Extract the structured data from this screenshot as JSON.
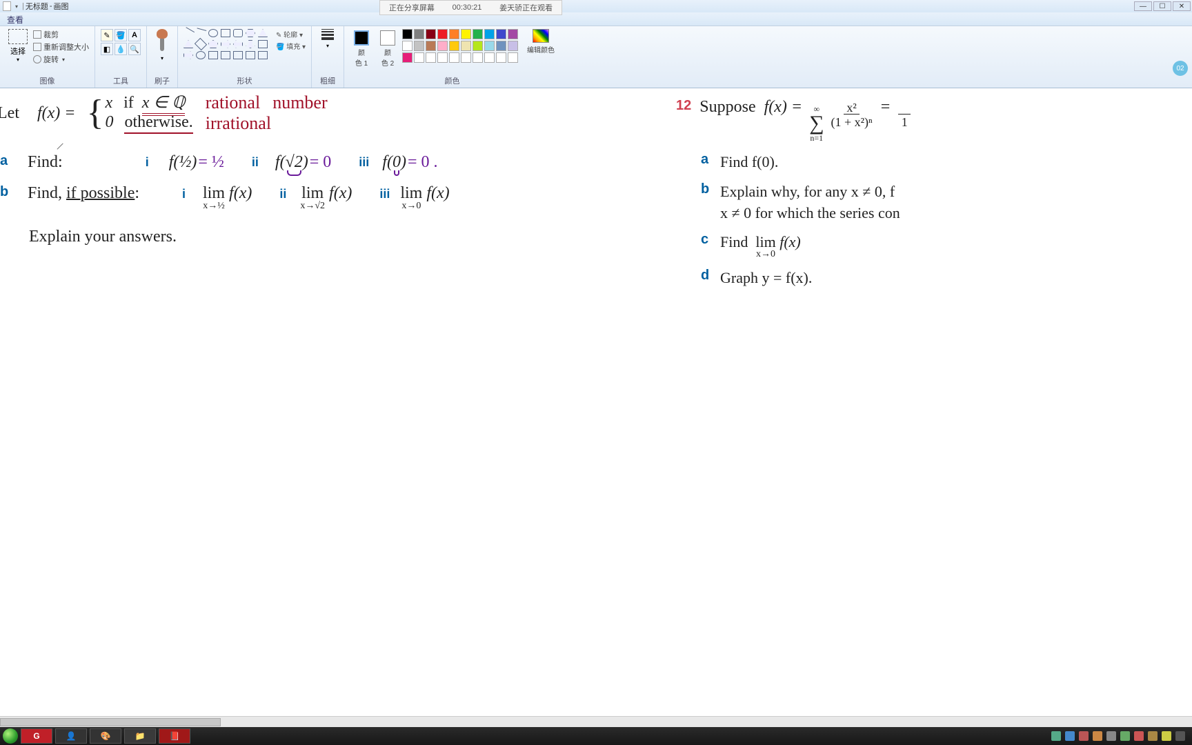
{
  "title_bar": {
    "doc_name": "无标题",
    "app_name": "画图"
  },
  "share": {
    "sharing": "正在分享屏幕",
    "time": "00:30:21",
    "viewer": "姜天骄正在观看"
  },
  "menu": {
    "view": "查看"
  },
  "ribbon": {
    "image": {
      "select": "选择",
      "crop": "裁剪",
      "resize": "重新调整大小",
      "rotate": "旋转",
      "label": "图像"
    },
    "tools": {
      "label": "工具"
    },
    "brush": {
      "label": "刷子"
    },
    "shapes": {
      "outline": "轮廓",
      "fill": "填充",
      "label": "形状"
    },
    "stroke": {
      "label": "粗细"
    },
    "color1": {
      "label_top": "颜",
      "label_bot": "色 1"
    },
    "color2": {
      "label_top": "颜",
      "label_bot": "色 2"
    },
    "edit_colors": "编辑颜色",
    "colors_label": "颜色",
    "badge": "02"
  },
  "math_left": {
    "let": "Let",
    "fx_eq": "f(x) =",
    "case1_val": "x",
    "case1_cond_if": "if",
    "case1_cond": "x ∈ ℚ",
    "case2_val": "0",
    "case2_cond": "otherwise.",
    "hand_rational": "rational",
    "hand_number": "number",
    "hand_irrational": "irrational",
    "a": "a",
    "a_text": "Find:",
    "a_i": "i",
    "a_i_expr": "f(½)",
    "a_i_ans": "= ½",
    "a_ii": "ii",
    "a_ii_expr": "f(√2)",
    "a_ii_ans": "= 0",
    "a_iii": "iii",
    "a_iii_expr": "f(0)",
    "a_iii_ans": "= 0 .",
    "b": "b",
    "b_text_find": "Find, ",
    "b_text_if": "if possible",
    "b_text_colon": ":",
    "b_i": "i",
    "b_i_lim": "lim",
    "b_i_sub": "x→½",
    "b_i_fx": "f(x)",
    "b_ii": "ii",
    "b_ii_lim": "lim",
    "b_ii_sub": "x→√2",
    "b_ii_fx": "f(x)",
    "b_iii": "iii",
    "b_iii_lim": "lim",
    "b_iii_sub": "x→0",
    "b_iii_fx": "f(x)",
    "explain": "Explain your answers."
  },
  "math_right": {
    "num": "12",
    "suppose": "Suppose",
    "fx_eq": "f(x) =",
    "sum_top": "∞",
    "sum_bot": "n=1",
    "frac_num": "x²",
    "frac_den": "(1 + x²)ⁿ",
    "equals": "=",
    "rfrac_den": "1",
    "a": "a",
    "a_text": "Find  f(0).",
    "b": "b",
    "b_text1": "Explain why, for any  x ≠ 0,  f",
    "b_text2": "x ≠ 0  for which the series con",
    "c": "c",
    "c_find": "Find",
    "c_lim": "lim",
    "c_sub": "x→0",
    "c_fx": "f(x)",
    "d": "d",
    "d_text": "Graph  y = f(x)."
  },
  "taskbar": {
    "items": [
      "G",
      "👤",
      "🎨",
      "📁",
      "📕"
    ]
  },
  "palette_row1": [
    "#000000",
    "#7f7f7f",
    "#880015",
    "#ed1c24",
    "#ff7f27",
    "#fff200",
    "#22b14c",
    "#00a2e8",
    "#3f48cc",
    "#a349a4"
  ],
  "palette_row2": [
    "#ffffff",
    "#c3c3c3",
    "#b97a57",
    "#ffaec9",
    "#ffc90e",
    "#efe4b0",
    "#b5e61d",
    "#99d9ea",
    "#7092be",
    "#c8bfe7"
  ],
  "palette_row3": [
    "#e61e78",
    "#ffffff",
    "#ffffff",
    "#ffffff",
    "#ffffff",
    "#ffffff",
    "#ffffff",
    "#ffffff",
    "#ffffff",
    "#ffffff"
  ]
}
